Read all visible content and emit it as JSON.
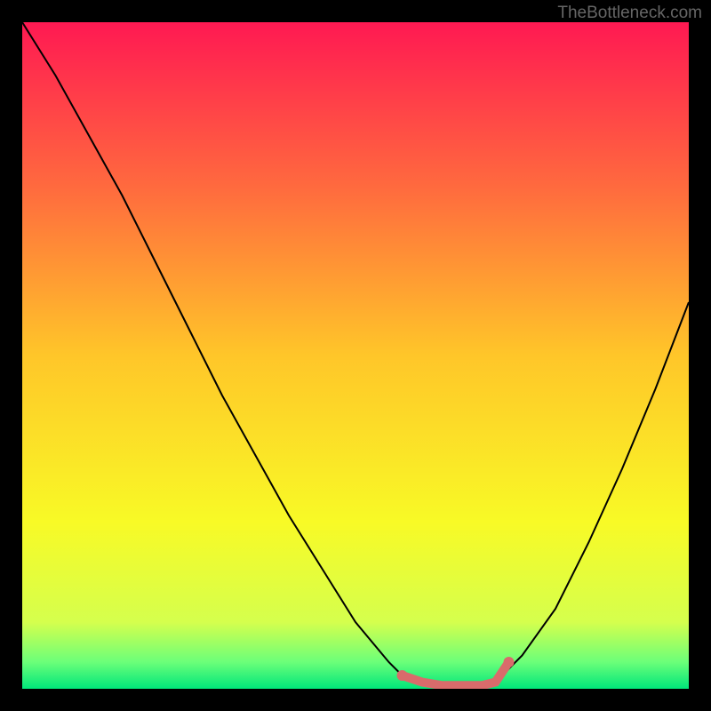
{
  "watermark": "TheBottleneck.com",
  "chart_data": {
    "type": "line",
    "title": "",
    "xlabel": "",
    "ylabel": "",
    "xlim": [
      0,
      100
    ],
    "ylim": [
      0,
      100
    ],
    "gradient_stops": [
      {
        "offset": 0,
        "color": "#ff1952"
      },
      {
        "offset": 25,
        "color": "#ff6b3e"
      },
      {
        "offset": 50,
        "color": "#ffc629"
      },
      {
        "offset": 75,
        "color": "#f8fa26"
      },
      {
        "offset": 90,
        "color": "#d5ff4d"
      },
      {
        "offset": 96,
        "color": "#6bff79"
      },
      {
        "offset": 100,
        "color": "#00e67a"
      }
    ],
    "series": [
      {
        "name": "bottleneck-curve",
        "color": "#000000",
        "x": [
          0,
          5,
          10,
          15,
          20,
          25,
          30,
          35,
          40,
          45,
          50,
          55,
          57,
          60,
          65,
          68,
          70,
          72,
          75,
          80,
          85,
          90,
          95,
          100
        ],
        "y": [
          100,
          92,
          83,
          74,
          64,
          54,
          44,
          35,
          26,
          18,
          10,
          4,
          2,
          1,
          0.5,
          0.5,
          1,
          2,
          5,
          12,
          22,
          33,
          45,
          58
        ]
      }
    ],
    "highlight": {
      "name": "optimal-range",
      "color": "#d96b6b",
      "width": 10,
      "x": [
        57,
        60,
        63,
        66,
        69,
        71,
        73
      ],
      "y": [
        2,
        1,
        0.5,
        0.5,
        0.5,
        1,
        4
      ]
    },
    "highlight_dots": {
      "color": "#d96b6b",
      "radius": 6,
      "points": [
        {
          "x": 57,
          "y": 2
        },
        {
          "x": 73,
          "y": 4
        }
      ]
    }
  }
}
